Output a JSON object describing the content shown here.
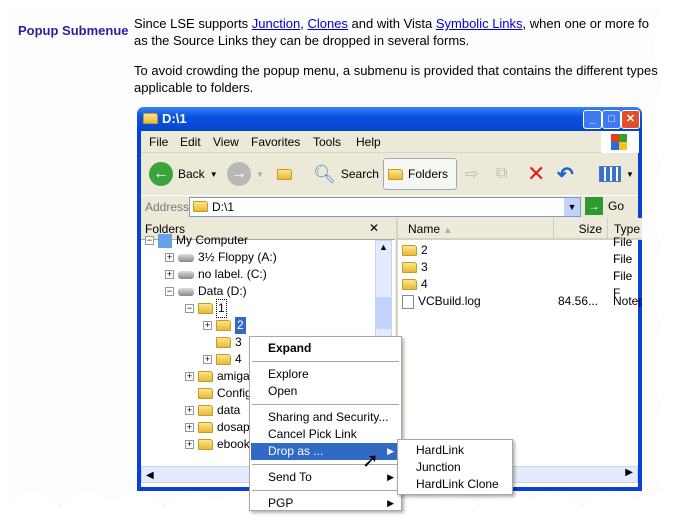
{
  "doc": {
    "label": "Popup Submenue",
    "p1_prefix": "Since LSE supports ",
    "link_junction": "Junction",
    "comma": ", ",
    "link_clones": "Clones",
    "p1_mid": " and with Vista ",
    "link_symbolic": "Symbolic Links",
    "p1_suffix": ", when one or more fo",
    "p1_line2": "as the Source Links they can be dropped in several forms.",
    "p2_line1": "To avoid crowding the popup menu, a submenu is provided that contains the different types",
    "p2_line2": "applicable to folders."
  },
  "window": {
    "title": "D:\\1",
    "menu": [
      "File",
      "Edit",
      "View",
      "Favorites",
      "Tools",
      "Help"
    ],
    "toolbar": {
      "back": "Back",
      "search": "Search",
      "folders": "Folders"
    },
    "address": {
      "label": "Address",
      "value": "D:\\1",
      "go": "Go"
    },
    "folders_pane": {
      "title": "Folders",
      "close": "✕",
      "tree": [
        "My Computer",
        "3½ Floppy (A:)",
        "no label. (C:)",
        "Data (D:)",
        "1",
        "2",
        "3",
        "4",
        "amiga",
        "Config",
        "data",
        "dosap",
        "ebook"
      ]
    },
    "list": {
      "columns": [
        "Name",
        "Size",
        "Type"
      ],
      "rows": [
        {
          "name": "2",
          "size": "",
          "type": "File F"
        },
        {
          "name": "3",
          "size": "",
          "type": "File F"
        },
        {
          "name": "4",
          "size": "",
          "type": "File F"
        },
        {
          "name": "VCBuild.log",
          "size": "84.56...",
          "type": "Notep"
        }
      ]
    }
  },
  "context_menu": {
    "items": [
      "Expand",
      "Explore",
      "Open",
      "Sharing and Security...",
      "Cancel Pick Link",
      "Drop as ...",
      "Send To",
      "PGP"
    ],
    "submenu": [
      "HardLink",
      "Junction",
      "HardLink Clone"
    ]
  },
  "colors": {
    "title_bar": "#0a52e0",
    "selection": "#316ac5",
    "label": "#2a1fa0",
    "link": "#0000cc"
  }
}
